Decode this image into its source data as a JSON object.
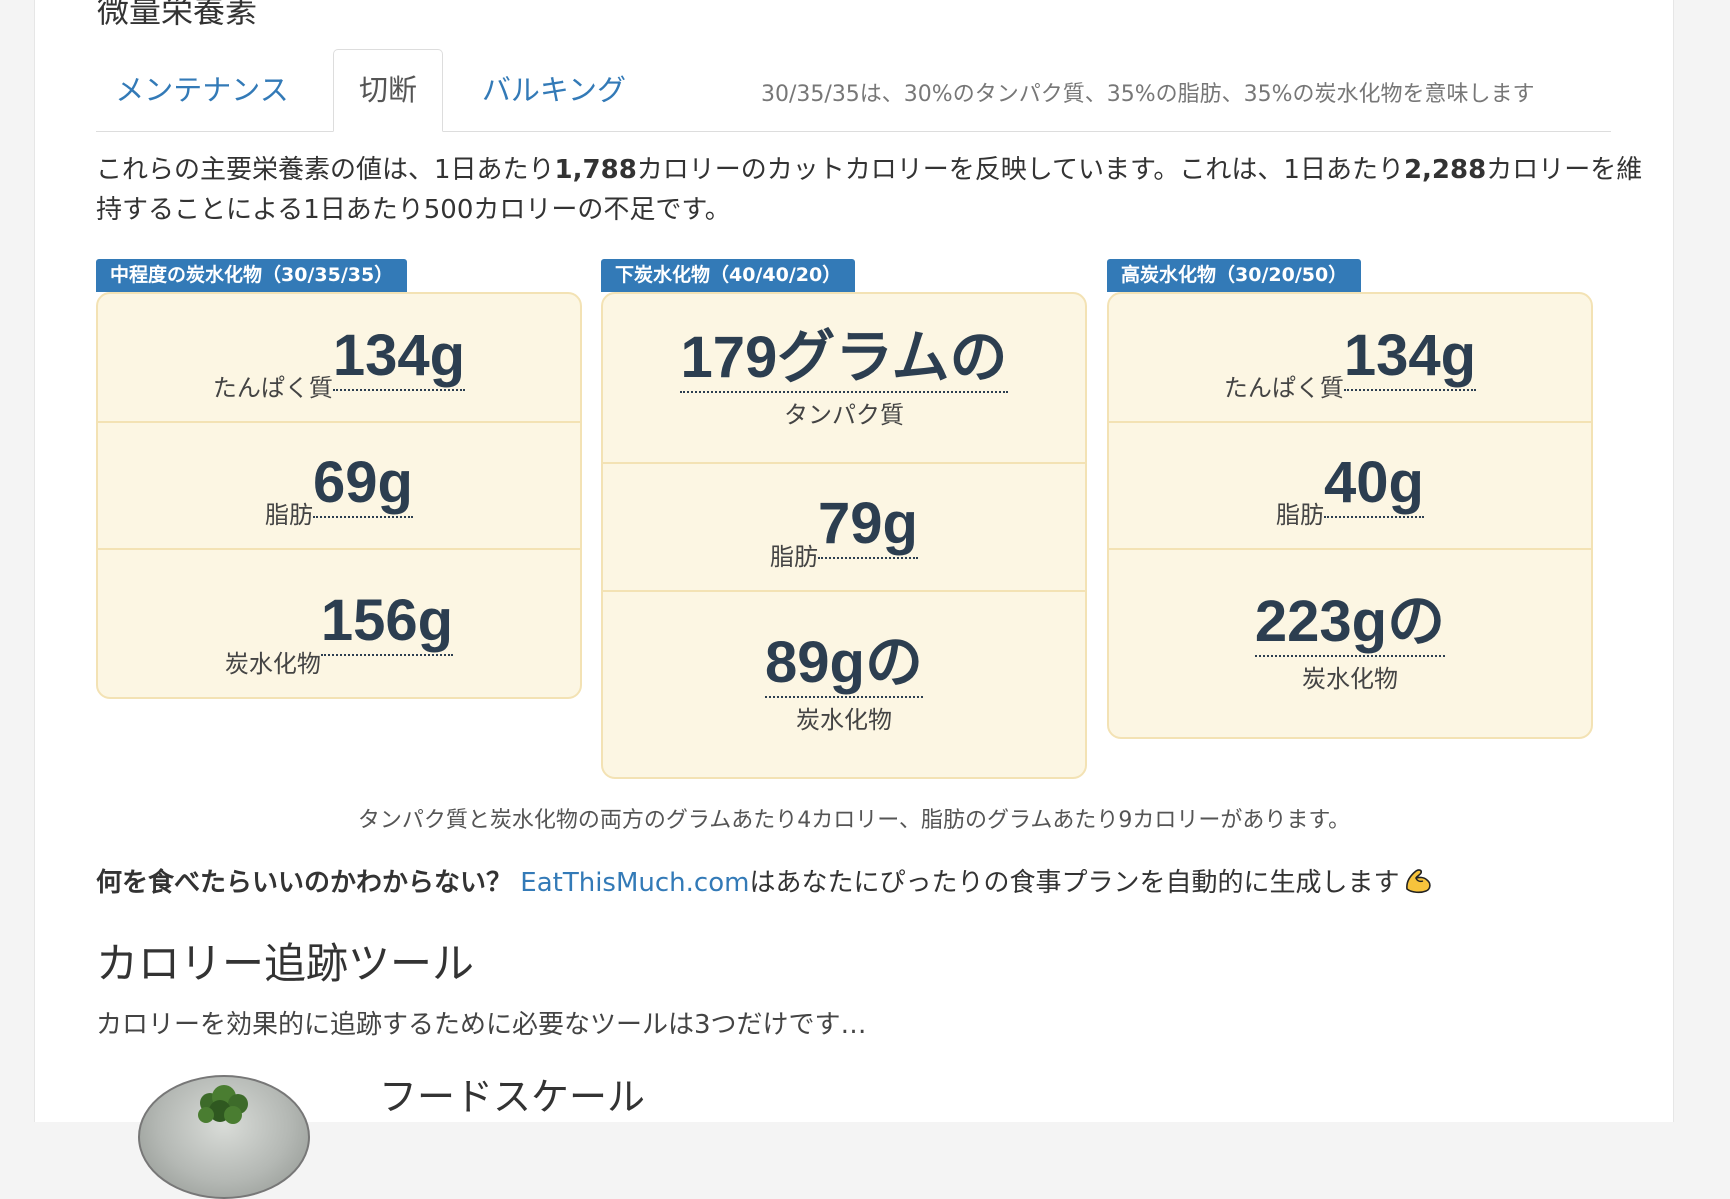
{
  "section_title": "微量栄養素",
  "tabs": [
    {
      "label": "メンテナンス",
      "active": false
    },
    {
      "label": "切断",
      "active": true
    },
    {
      "label": "バルキング",
      "active": false
    }
  ],
  "tab_note": "30/35/35は、30%のタンパク質、35%の脂肪、35%の炭水化物を意味します",
  "intro": {
    "p1": "これらの主要栄養素の値は、1日あたり",
    "calories_cut": "1,788",
    "p2": "カロリーのカットカロリーを反映しています。これは、1日あたり",
    "calories_maintain": "2,288",
    "p3": "カロリーを維持することによる1日あたり500カロリーの不足です。"
  },
  "cards": [
    {
      "badge": "中程度の炭水化物（30/35/35）",
      "rows": [
        {
          "label": "たんぱく質",
          "value": "134g"
        },
        {
          "label": "脂肪",
          "value": "69g"
        },
        {
          "label": "炭水化物",
          "value": "156g"
        }
      ]
    },
    {
      "badge": "下炭水化物（40/40/20）",
      "rows": [
        {
          "label": "タンパク質",
          "value": "179グラムの"
        },
        {
          "label": "脂肪",
          "value": "79g"
        },
        {
          "label": "炭水化物",
          "value": "89gの"
        }
      ]
    },
    {
      "badge": "高炭水化物（30/20/50）",
      "rows": [
        {
          "label": "たんぱく質",
          "value": "134g"
        },
        {
          "label": "脂肪",
          "value": "40g"
        },
        {
          "label": "炭水化物",
          "value": "223gの"
        }
      ]
    }
  ],
  "calorie_note": "タンパク質と炭水化物の両方のグラムあたり4カロリー、脂肪のグラムあたり9カロリーがあります。",
  "cta": {
    "question": "何を食べたらいいのかわからない？",
    "link": "EatThisMuch.com",
    "rest": "はあなたにぴったりの食事プランを自動的に生成します",
    "emoji": "flexed-biceps-icon"
  },
  "tracking": {
    "heading": "カロリー追跡ツール",
    "subtitle": "カロリーを効果的に追跡するために必要なツールは3つだけです…",
    "tool1_title": "フードスケール"
  },
  "colors": {
    "accent": "#337ab7",
    "card_bg": "#fcf6e3",
    "card_border": "#f3e2b4",
    "value": "#2c3e50"
  }
}
